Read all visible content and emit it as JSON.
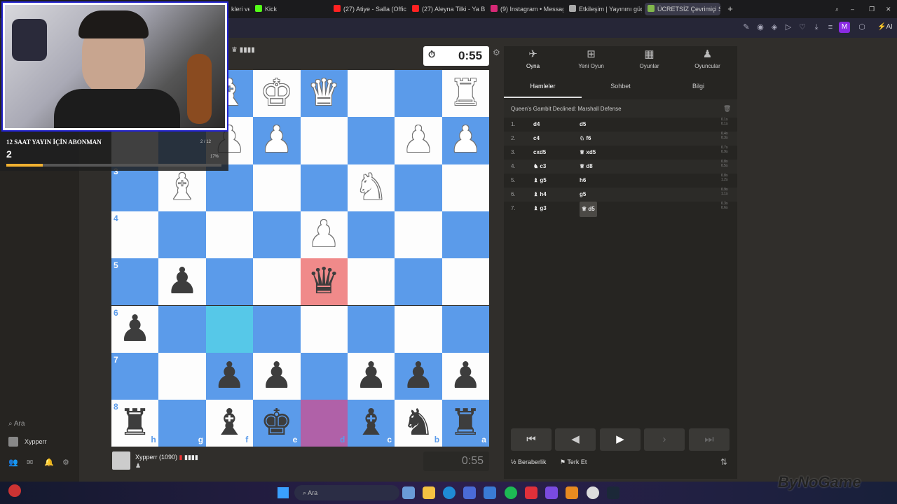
{
  "browser": {
    "tabs": [
      {
        "label": "kleri ve",
        "color": "#777"
      },
      {
        "label": "Kick",
        "color": "#53fc18"
      },
      {
        "label": "(27) Atiye - Salla (Official",
        "color": "#ff2222"
      },
      {
        "label": "(27) Aleyna Tilki - Ya Bu İş",
        "color": "#ff2222"
      },
      {
        "label": "(9) Instagram • Messages",
        "color": "#d62976"
      },
      {
        "label": "Etkileşim | Yayınını güç",
        "color": "#aaaaaa"
      },
      {
        "label": "ÜCRETSİZ Çevrimiçi S",
        "color": "#81b64c"
      }
    ],
    "new_tab": "+",
    "profile_initial": "M",
    "ai_label": "AI"
  },
  "overlay": {
    "subgoal_title": "12 SAAT YAYIN İÇİN ABONMAN",
    "subgoal_count": "2",
    "subgoal_fraction": "2 / 12",
    "subgoal_percent": "17%",
    "subgoal_progress": 0.17
  },
  "leftnav": {
    "search_label": "Ara",
    "user_label": "Xypperr"
  },
  "game": {
    "opponent_clock": "0:55",
    "player_name": "Xypperr (1090)",
    "player_clock": "0:55",
    "ranks": [
      "3",
      "4",
      "5",
      "6",
      "7",
      "8"
    ],
    "files": [
      "h",
      "g",
      "f",
      "e",
      "d",
      "c",
      "b",
      "a"
    ]
  },
  "panel": {
    "tabs": [
      {
        "label": "Oyna",
        "icon": "play-icon"
      },
      {
        "label": "Yeni Oyun",
        "icon": "plus-icon"
      },
      {
        "label": "Oyunlar",
        "icon": "board-icon"
      },
      {
        "label": "Oyuncular",
        "icon": "players-icon"
      }
    ],
    "subtabs": [
      "Hamleler",
      "Sohbet",
      "Bilgi"
    ],
    "opening": "Queen's Gambit Declined: Marshall Defense",
    "moves": [
      {
        "num": "1.",
        "white": "d4",
        "black": "d5",
        "tw": "0.1s",
        "tb": "0.1s"
      },
      {
        "num": "2.",
        "white": "c4",
        "black": "♘ f6",
        "tw": "0.4s",
        "tb": "0.3s"
      },
      {
        "num": "3.",
        "white": "cxd5",
        "black": "♕ xd5",
        "tw": "0.7s",
        "tb": "0.9s"
      },
      {
        "num": "4.",
        "white": "♞ c3",
        "black": "♕ d8",
        "tw": "0.8s",
        "tb": "0.5s"
      },
      {
        "num": "5.",
        "white": "♝ g5",
        "black": "h6",
        "tw": "0.8s",
        "tb": "1.2s"
      },
      {
        "num": "6.",
        "white": "♝ h4",
        "black": "g5",
        "tw": "0.9s",
        "tb": "1.1s"
      },
      {
        "num": "7.",
        "white": "♝ g3",
        "black": "♕ d5",
        "tw": "0.3s",
        "tb": "0.6s"
      }
    ],
    "draw_label": "Beraberlik",
    "resign_label": "Terk Et"
  },
  "taskbar": {
    "search_placeholder": "Ara",
    "watermark": "ByNoGame"
  }
}
